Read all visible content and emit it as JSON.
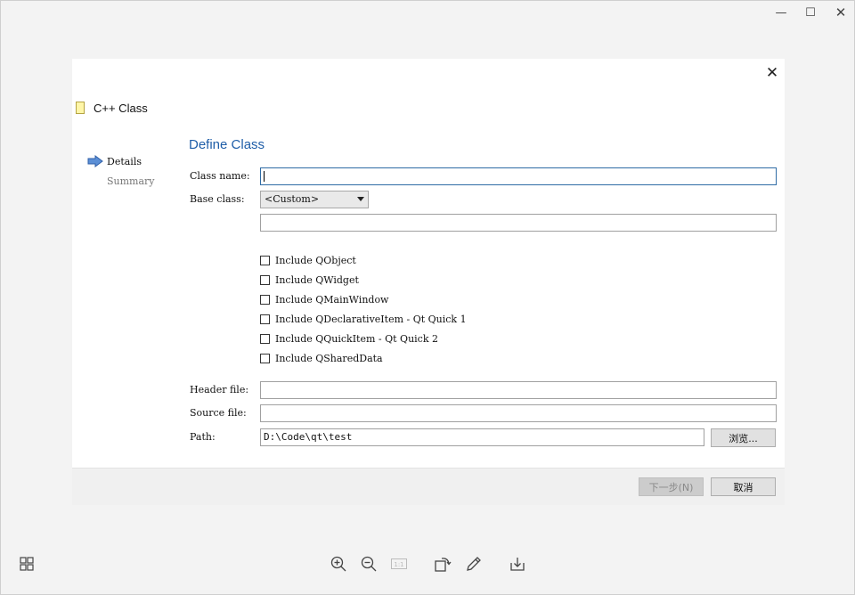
{
  "window": {
    "controls": {
      "minimize": "—",
      "maximize": "☐",
      "close": "✕"
    }
  },
  "dialog": {
    "close_glyph": "✕",
    "title": "C++ Class",
    "steps": [
      {
        "label": "Details",
        "active": true
      },
      {
        "label": "Summary",
        "active": false
      }
    ],
    "page_title": "Define Class",
    "fields": {
      "class_name_label": "Class name:",
      "class_name_value": "",
      "base_class_label": "Base class:",
      "base_class_selected": "<Custom>",
      "custom_base_value": "",
      "header_file_label": "Header file:",
      "header_file_value": "",
      "source_file_label": "Source file:",
      "source_file_value": "",
      "path_label": "Path:",
      "path_value": "D:\\Code\\qt\\test",
      "browse_label": "浏览..."
    },
    "checkboxes": [
      {
        "label": "Include QObject",
        "checked": false
      },
      {
        "label": "Include QWidget",
        "checked": false
      },
      {
        "label": "Include QMainWindow",
        "checked": false
      },
      {
        "label": "Include QDeclarativeItem - Qt Quick 1",
        "checked": false
      },
      {
        "label": "Include QQuickItem - Qt Quick 2",
        "checked": false
      },
      {
        "label": "Include QSharedData",
        "checked": false
      }
    ],
    "footer": {
      "next_label": "下一步(N)",
      "cancel_label": "取消"
    }
  },
  "viewer_toolbar": {
    "items": [
      "grid-view-icon",
      "zoom-in-icon",
      "zoom-out-icon",
      "actual-size-icon",
      "rotate-icon",
      "edit-icon",
      "download-icon"
    ],
    "actual_size_label": "1:1"
  },
  "colors": {
    "accent": "#1f5ea8",
    "focus_border": "#2f6ca5"
  }
}
